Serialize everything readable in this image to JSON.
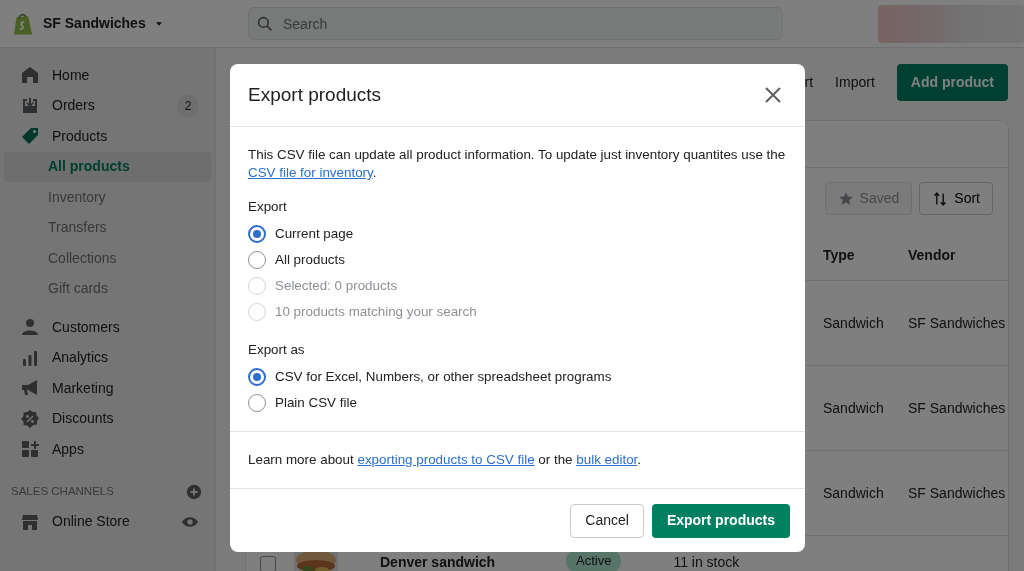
{
  "topbar": {
    "store_name": "SF Sandwiches",
    "search_placeholder": "Search"
  },
  "sidebar": {
    "items": [
      {
        "label": "Home"
      },
      {
        "label": "Orders",
        "badge": "2"
      },
      {
        "label": "Products",
        "children": [
          {
            "label": "All products",
            "selected": true
          },
          {
            "label": "Inventory",
            "selected": false
          },
          {
            "label": "Transfers",
            "selected": false
          },
          {
            "label": "Collections",
            "selected": false
          },
          {
            "label": "Gift cards",
            "selected": false
          }
        ]
      },
      {
        "label": "Customers"
      },
      {
        "label": "Analytics"
      },
      {
        "label": "Marketing"
      },
      {
        "label": "Discounts"
      },
      {
        "label": "Apps"
      }
    ],
    "sales_channels": {
      "heading": "SALES CHANNELS",
      "items": [
        {
          "label": "Online Store"
        }
      ]
    }
  },
  "page": {
    "actions": [
      {
        "label": "rt",
        "kind": "plain"
      },
      {
        "label": "Import",
        "kind": "plain"
      },
      {
        "label": "Add product",
        "kind": "primary"
      }
    ],
    "filter_buttons": [
      {
        "label": "Saved",
        "disabled": true
      },
      {
        "label": "Sort",
        "disabled": false
      }
    ],
    "table": {
      "columns": [
        "Type",
        "Vendor"
      ],
      "rows": [
        {
          "type": "Sandwich",
          "vendor": "SF Sandwiches"
        },
        {
          "type": "Sandwich",
          "vendor": "SF Sandwiches"
        },
        {
          "type": "Sandwich",
          "vendor": "SF Sandwiches"
        }
      ],
      "partial_row": {
        "checked": false,
        "name": "Denver sandwich",
        "status": "Active",
        "inventory": "11 in stock"
      }
    }
  },
  "modal": {
    "title": "Export products",
    "intro": [
      {
        "text": "This CSV file can update all product information. To update just inventory quantites use the ",
        "link": false
      },
      {
        "text": "CSV file for inventory",
        "link": true
      },
      {
        "text": ".",
        "link": false
      }
    ],
    "groups": [
      {
        "label": "Export",
        "options": [
          {
            "label": "Current page",
            "selected": true,
            "disabled": false
          },
          {
            "label": "All products",
            "selected": false,
            "disabled": false
          },
          {
            "label": "Selected: 0 products",
            "selected": false,
            "disabled": true
          },
          {
            "label": "10 products matching your search",
            "selected": false,
            "disabled": true
          }
        ]
      },
      {
        "label": "Export as",
        "options": [
          {
            "label": "CSV for Excel, Numbers, or other spreadsheet programs",
            "selected": true,
            "disabled": false
          },
          {
            "label": "Plain CSV file",
            "selected": false,
            "disabled": false
          }
        ]
      }
    ],
    "note": [
      {
        "text": "Learn more about ",
        "link": false
      },
      {
        "text": "exporting products to CSV file",
        "link": true
      },
      {
        "text": " or the ",
        "link": false
      },
      {
        "text": "bulk editor",
        "link": true
      },
      {
        "text": ".",
        "link": false
      }
    ],
    "buttons": [
      {
        "label": "Cancel",
        "kind": "secondary"
      },
      {
        "label": "Export products",
        "kind": "primary"
      }
    ]
  }
}
